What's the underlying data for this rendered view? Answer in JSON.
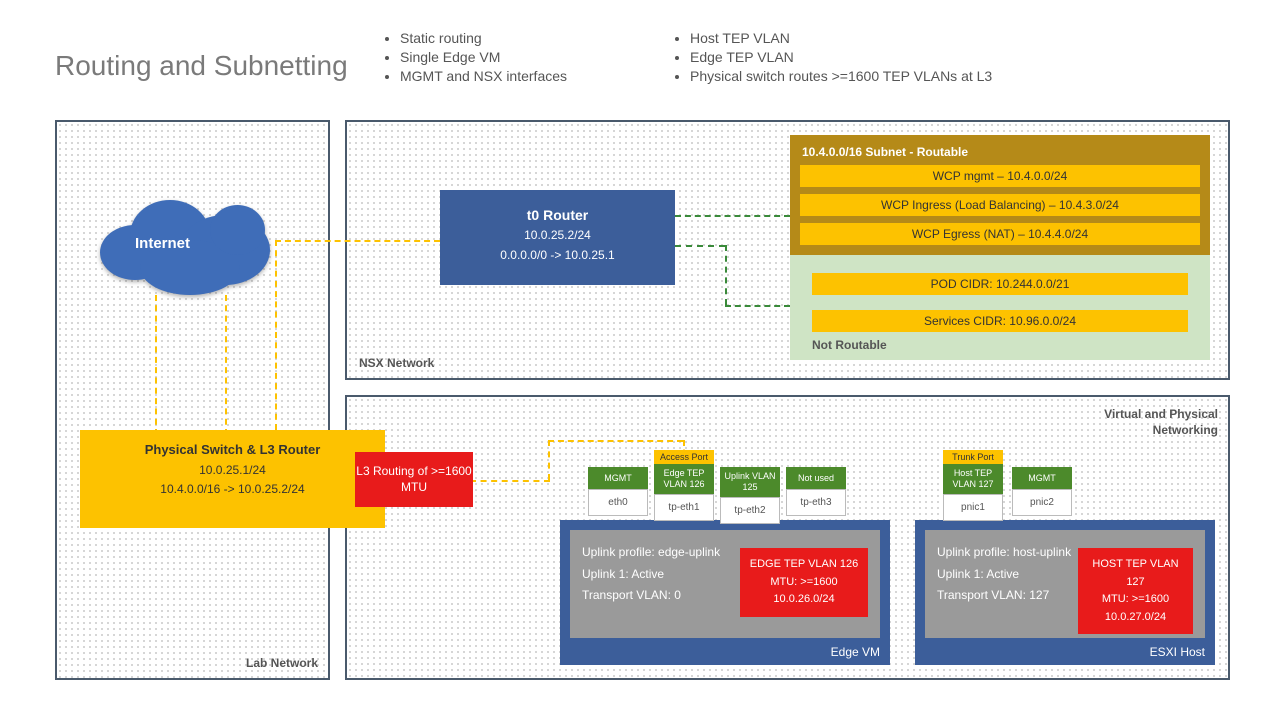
{
  "title": "Routing and Subnetting",
  "bullets_left": [
    "Static routing",
    "Single Edge VM",
    "MGMT and NSX interfaces"
  ],
  "bullets_right": [
    "Host TEP VLAN",
    "Edge TEP VLAN",
    "Physical switch routes >=1600 TEP VLANs at L3"
  ],
  "panels": {
    "lab": "Lab Network",
    "nsx": "NSX Network",
    "vpn_l1": "Virtual and Physical",
    "vpn_l2": "Networking"
  },
  "cloud": "Internet",
  "pswitch": {
    "title": "Physical Switch & L3 Router",
    "line1": "10.0.25.1/24",
    "line2": "10.4.0.0/16  -> 10.0.25.2/24"
  },
  "l3box": "L3 Routing of >=1600 MTU",
  "t0": {
    "title": "t0 Router",
    "line1": "10.0.25.2/24",
    "line2": "0.0.0.0/0 -> 10.0.25.1"
  },
  "routable": {
    "title": "10.4.0.0/16 Subnet - Routable",
    "bars": [
      "WCP mgmt – 10.4.0.0/24",
      "WCP Ingress (Load Balancing) – 10.4.3.0/24",
      "WCP Egress (NAT) – 10.4.4.0/24"
    ]
  },
  "notroutable": {
    "label": "Not Routable",
    "bars": [
      "POD CIDR: 10.244.0.0/21",
      "Services CIDR: 10.96.0.0/24"
    ]
  },
  "edgevm": {
    "label": "Edge VM",
    "info": [
      "Uplink profile: edge-uplink",
      "Uplink 1: Active",
      "Transport VLAN: 0"
    ],
    "red": [
      "EDGE TEP VLAN 126",
      "MTU: >=1600",
      "10.0.26.0/24"
    ],
    "ports": [
      {
        "tag": "",
        "head": "MGMT",
        "cell": "eth0"
      },
      {
        "tag": "Access Port",
        "head": "Edge TEP VLAN 126",
        "cell": "tp-eth1"
      },
      {
        "tag": "",
        "head": "Uplink VLAN 125",
        "cell": "tp-eth2"
      },
      {
        "tag": "",
        "head": "Not used",
        "cell": "tp-eth3"
      }
    ]
  },
  "esxi": {
    "label": "ESXI Host",
    "info": [
      "Uplink profile: host-uplink",
      "Uplink 1: Active",
      "Transport VLAN: 127"
    ],
    "red": [
      "HOST TEP VLAN 127",
      "MTU: >=1600",
      "10.0.27.0/24"
    ],
    "ports": [
      {
        "tag": "Trunk Port",
        "head": "Host TEP VLAN 127",
        "cell": "pnic1"
      },
      {
        "tag": "",
        "head": "MGMT",
        "cell": "pnic2"
      }
    ]
  }
}
